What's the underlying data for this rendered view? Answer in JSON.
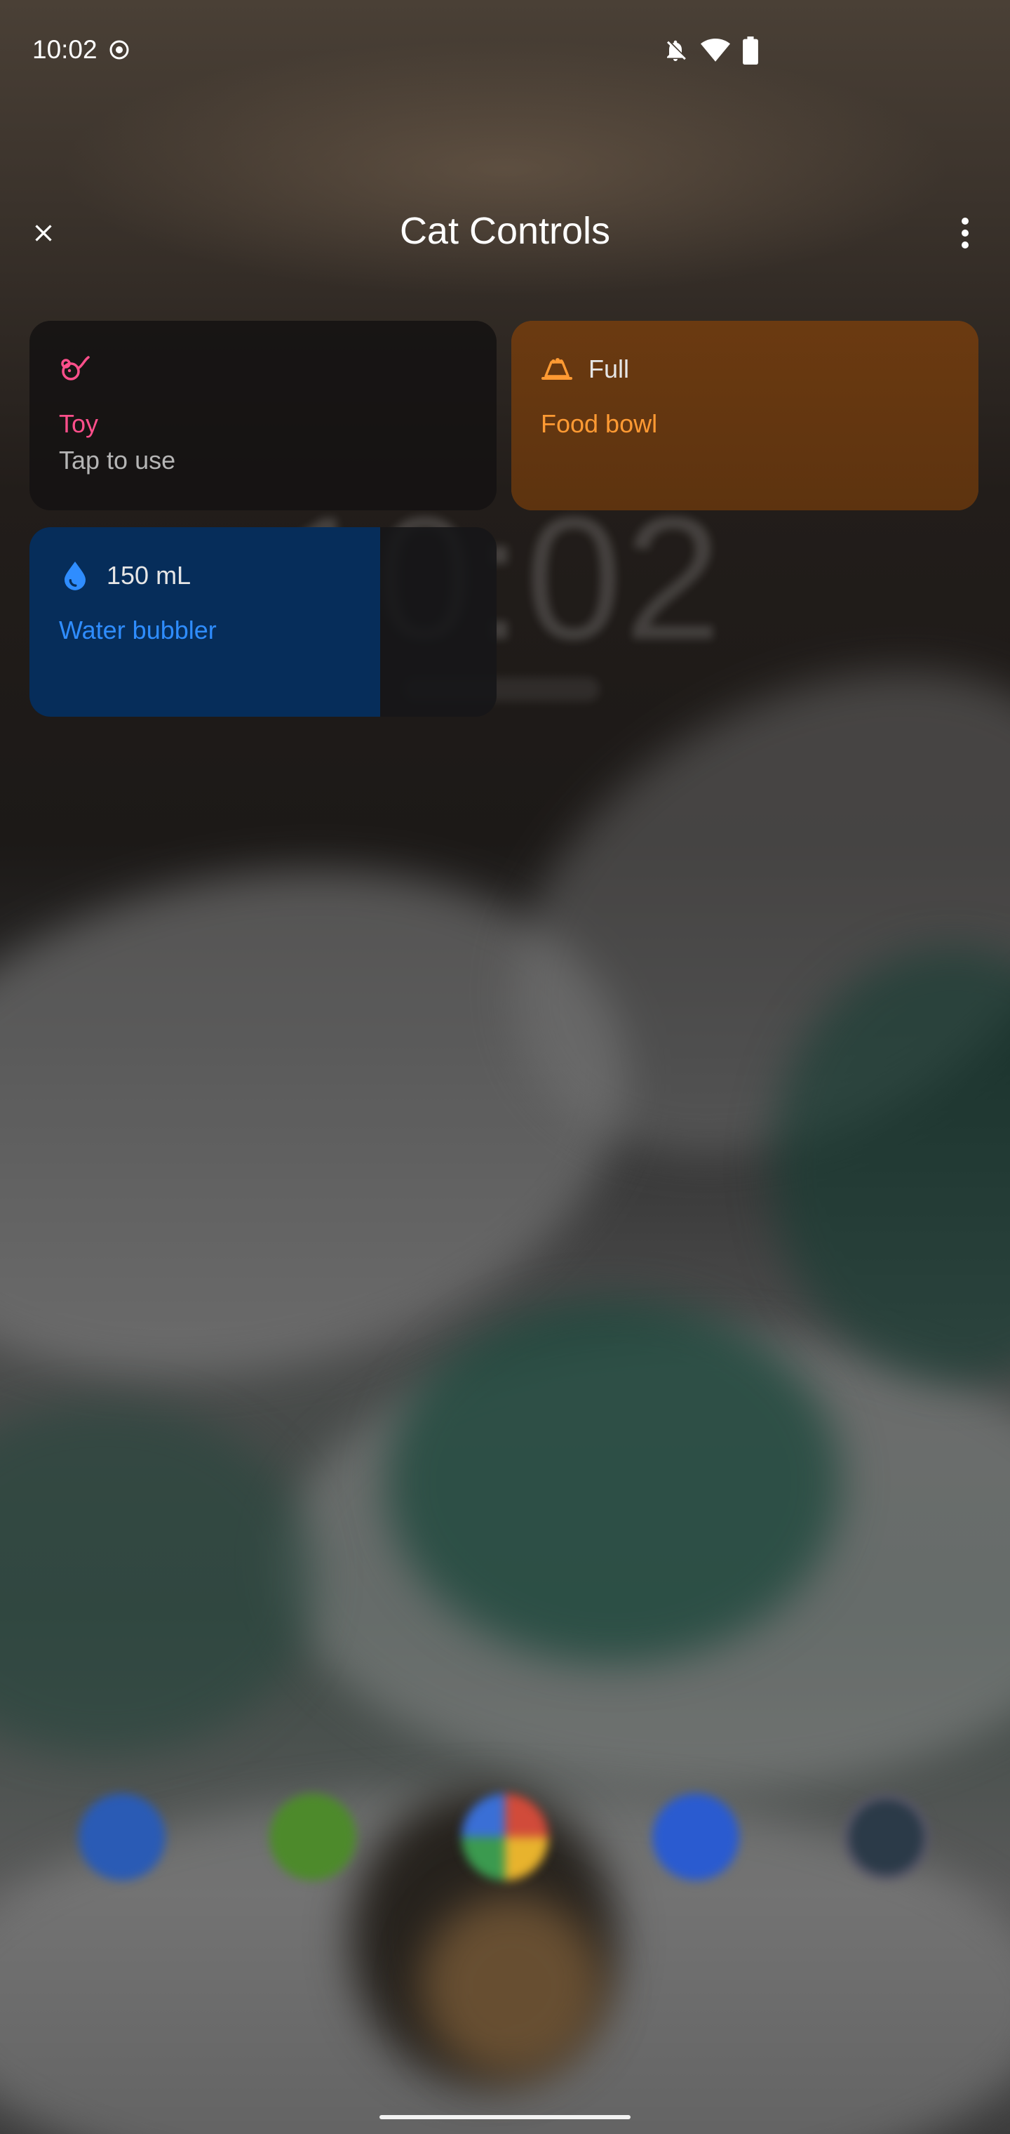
{
  "status_bar": {
    "time": "10:02",
    "icons": [
      "record-icon",
      "notifications-off-icon",
      "wifi-icon",
      "battery-icon"
    ]
  },
  "header": {
    "title": "Cat Controls",
    "close_icon": "close-icon",
    "more_icon": "more-vertical-icon"
  },
  "controls": [
    {
      "id": "toy",
      "icon": "toy-mouse-icon",
      "status": "",
      "title": "Toy",
      "subtitle": "Tap to use",
      "accent": "#ff4f8b"
    },
    {
      "id": "food",
      "icon": "food-bowl-icon",
      "status": "Full",
      "title": "Food bowl",
      "subtitle": "",
      "accent": "#ff9a33",
      "level": 1.0
    },
    {
      "id": "water",
      "icon": "water-drop-icon",
      "status": "150 mL",
      "title": "Water bubbler",
      "subtitle": "",
      "accent": "#2f8dff",
      "level": 0.75
    }
  ],
  "background": {
    "clock": "10:02"
  }
}
